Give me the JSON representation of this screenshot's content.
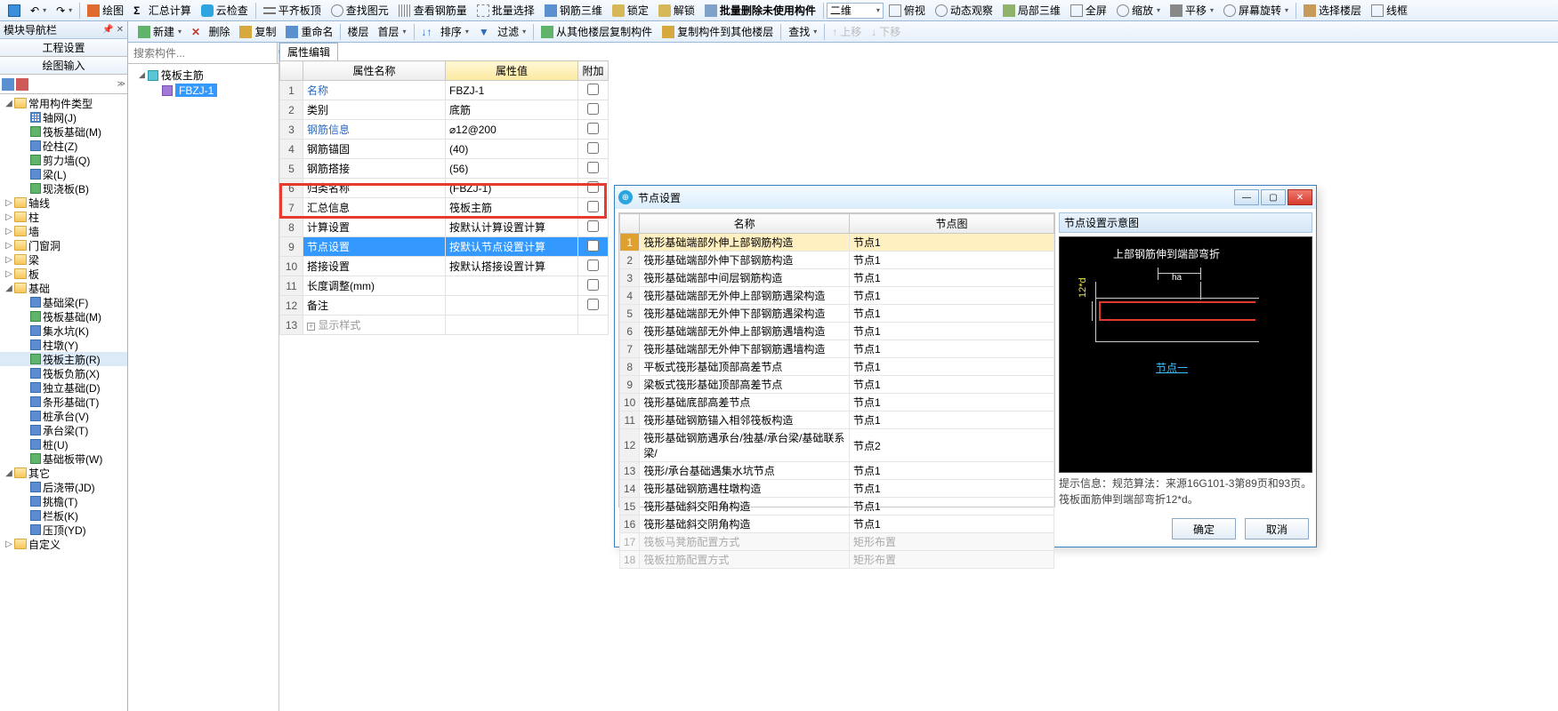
{
  "toolbar1": {
    "items": [
      "绘图",
      "汇总计算",
      "云检查",
      "平齐板顶",
      "查找图元",
      "查看钢筋量",
      "批量选择",
      "钢筋三维",
      "锁定",
      "解锁",
      "批量删除未使用构件"
    ],
    "combo": "二维",
    "right": [
      "俯视",
      "动态观察",
      "局部三维",
      "全屏",
      "缩放",
      "平移",
      "屏幕旋转",
      "选择楼层",
      "线框"
    ]
  },
  "toolbar2": {
    "items": [
      "新建",
      "删除",
      "复制",
      "重命名",
      "楼层",
      "首层",
      "排序",
      "过滤",
      "从其他楼层复制构件",
      "复制构件到其他楼层",
      "查找",
      "上移",
      "下移"
    ]
  },
  "nav": {
    "title": "模块导航栏",
    "tabs": [
      "工程设置",
      "绘图输入"
    ],
    "groups": [
      {
        "label": "常用构件类型",
        "expanded": true,
        "items": [
          {
            "label": "轴网(J)",
            "ico": "grid"
          },
          {
            "label": "筏板基础(M)",
            "ico": "green"
          },
          {
            "label": "砼柱(Z)",
            "ico": "blue"
          },
          {
            "label": "剪力墙(Q)",
            "ico": "green"
          },
          {
            "label": "梁(L)",
            "ico": "blue"
          },
          {
            "label": "现浇板(B)",
            "ico": "green"
          }
        ]
      },
      {
        "label": "轴线",
        "expanded": false
      },
      {
        "label": "柱",
        "expanded": false
      },
      {
        "label": "墙",
        "expanded": false
      },
      {
        "label": "门窗洞",
        "expanded": false
      },
      {
        "label": "梁",
        "expanded": false
      },
      {
        "label": "板",
        "expanded": false
      },
      {
        "label": "基础",
        "expanded": true,
        "items": [
          {
            "label": "基础梁(F)",
            "ico": "blue"
          },
          {
            "label": "筏板基础(M)",
            "ico": "green"
          },
          {
            "label": "集水坑(K)",
            "ico": "blue"
          },
          {
            "label": "柱墩(Y)",
            "ico": "blue"
          },
          {
            "label": "筏板主筋(R)",
            "ico": "green",
            "sel": true
          },
          {
            "label": "筏板负筋(X)",
            "ico": "blue"
          },
          {
            "label": "独立基础(D)",
            "ico": "blue"
          },
          {
            "label": "条形基础(T)",
            "ico": "blue"
          },
          {
            "label": "桩承台(V)",
            "ico": "blue"
          },
          {
            "label": "承台梁(T)",
            "ico": "blue"
          },
          {
            "label": "桩(U)",
            "ico": "blue"
          },
          {
            "label": "基础板带(W)",
            "ico": "green"
          }
        ]
      },
      {
        "label": "其它",
        "expanded": true,
        "items": [
          {
            "label": "后浇带(JD)",
            "ico": "blue"
          },
          {
            "label": "挑檐(T)",
            "ico": "blue"
          },
          {
            "label": "栏板(K)",
            "ico": "blue"
          },
          {
            "label": "压顶(YD)",
            "ico": "blue"
          }
        ]
      },
      {
        "label": "自定义",
        "expanded": false
      }
    ]
  },
  "mid": {
    "placeholder": "搜索构件...",
    "root": "筏板主筋",
    "child": "FBZJ-1"
  },
  "prop": {
    "tab": "属性编辑",
    "headers": [
      "属性名称",
      "属性值",
      "附加"
    ],
    "rows": [
      {
        "n": "1",
        "name": "名称",
        "val": "FBZJ-1",
        "link": true,
        "chk": false
      },
      {
        "n": "2",
        "name": "类别",
        "val": "底筋",
        "chk": true
      },
      {
        "n": "3",
        "name": "钢筋信息",
        "val": "⌀12@200",
        "link": true,
        "chk": true
      },
      {
        "n": "4",
        "name": "钢筋锚固",
        "val": "(40)",
        "chk": true
      },
      {
        "n": "5",
        "name": "钢筋搭接",
        "val": "(56)",
        "chk": true
      },
      {
        "n": "6",
        "name": "归类名称",
        "val": "(FBZJ-1)",
        "chk": true
      },
      {
        "n": "7",
        "name": "汇总信息",
        "val": "筏板主筋",
        "chk": true
      },
      {
        "n": "8",
        "name": "计算设置",
        "val": "按默认计算设置计算",
        "chk": false
      },
      {
        "n": "9",
        "name": "节点设置",
        "val": "按默认节点设置计算",
        "chk": false,
        "sel": true
      },
      {
        "n": "10",
        "name": "搭接设置",
        "val": "按默认搭接设置计算",
        "chk": false
      },
      {
        "n": "11",
        "name": "长度调整(mm)",
        "val": "",
        "chk": true
      },
      {
        "n": "12",
        "name": "备注",
        "val": "",
        "chk": true
      },
      {
        "n": "13",
        "name": "显示样式",
        "val": "",
        "expand": true,
        "gray": true
      }
    ]
  },
  "dialog": {
    "title": "节点设置",
    "headers": [
      "名称",
      "节点图"
    ],
    "rows": [
      {
        "n": "1",
        "a": "筏形基础端部外伸上部钢筋构造",
        "b": "节点1",
        "sel": true
      },
      {
        "n": "2",
        "a": "筏形基础端部外伸下部钢筋构造",
        "b": "节点1"
      },
      {
        "n": "3",
        "a": "筏形基础端部中间层钢筋构造",
        "b": "节点1"
      },
      {
        "n": "4",
        "a": "筏形基础端部无外伸上部钢筋遇梁构造",
        "b": "节点1"
      },
      {
        "n": "5",
        "a": "筏形基础端部无外伸下部钢筋遇梁构造",
        "b": "节点1"
      },
      {
        "n": "6",
        "a": "筏形基础端部无外伸上部钢筋遇墙构造",
        "b": "节点1"
      },
      {
        "n": "7",
        "a": "筏形基础端部无外伸下部钢筋遇墙构造",
        "b": "节点1"
      },
      {
        "n": "8",
        "a": "平板式筏形基础顶部高差节点",
        "b": "节点1"
      },
      {
        "n": "9",
        "a": "梁板式筏形基础顶部高差节点",
        "b": "节点1"
      },
      {
        "n": "10",
        "a": "筏形基础底部高差节点",
        "b": "节点1"
      },
      {
        "n": "11",
        "a": "筏形基础钢筋锚入相邻筏板构造",
        "b": "节点1"
      },
      {
        "n": "12",
        "a": "筏形基础钢筋遇承台/独基/承台梁/基础联系梁/",
        "b": "节点2"
      },
      {
        "n": "13",
        "a": "筏形/承台基础遇集水坑节点",
        "b": "节点1"
      },
      {
        "n": "14",
        "a": "筏形基础钢筋遇柱墩构造",
        "b": "节点1"
      },
      {
        "n": "15",
        "a": "筏形基础斜交阳角构造",
        "b": "节点1"
      },
      {
        "n": "16",
        "a": "筏形基础斜交阴角构造",
        "b": "节点1"
      },
      {
        "n": "17",
        "a": "筏板马凳筋配置方式",
        "b": "矩形布置",
        "gray": true
      },
      {
        "n": "18",
        "a": "筏板拉筋配置方式",
        "b": "矩形布置",
        "gray": true
      }
    ],
    "preview_title": "节点设置示意图",
    "preview_caption": "上部钢筋伸到端部弯折",
    "preview_ha": "ha",
    "preview_dim": "12*d",
    "preview_link": "节点一",
    "hint_label": "提示信息：",
    "hint": "规范算法：来源16G101-3第89页和93页。筏板面筋伸到端部弯折12*d。",
    "ok": "确定",
    "cancel": "取消"
  }
}
